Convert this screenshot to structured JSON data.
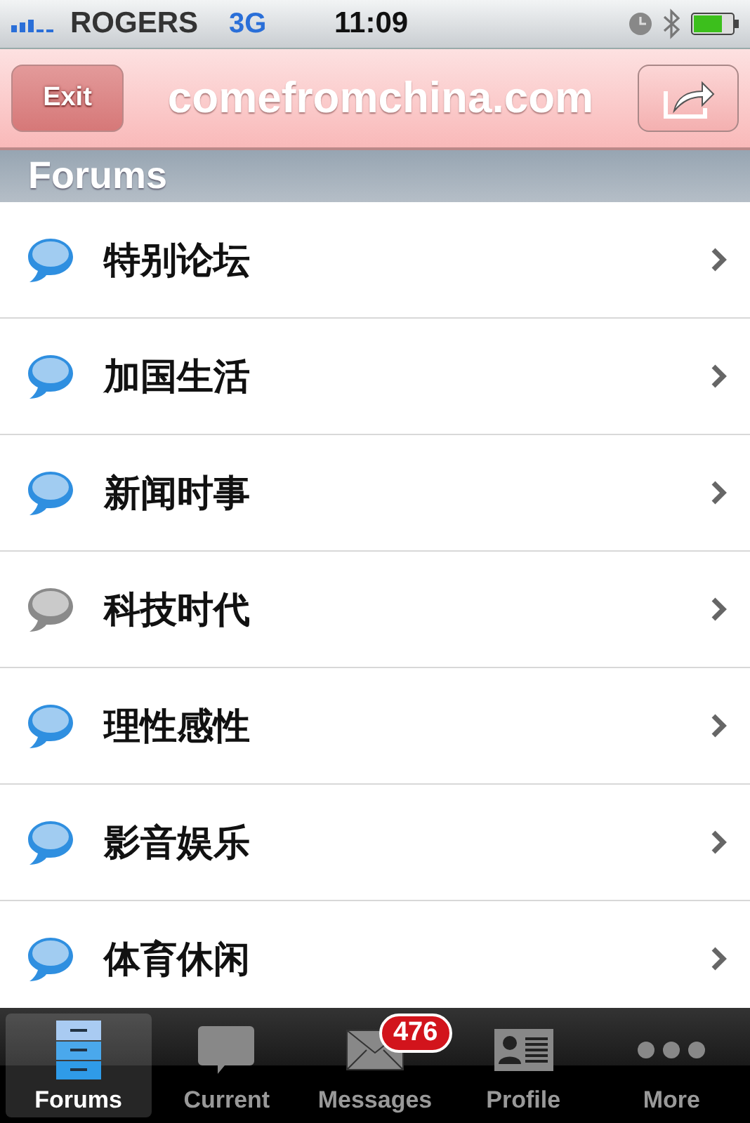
{
  "status_bar": {
    "carrier": "ROGERS",
    "network": "3G",
    "time": "11:09"
  },
  "header": {
    "exit": "Exit",
    "title": "comefromchina.com"
  },
  "section": {
    "title": "Forums"
  },
  "forums": [
    {
      "name": "特别论坛",
      "color": "#2f8fe0"
    },
    {
      "name": "加国生活",
      "color": "#2f8fe0"
    },
    {
      "name": "新闻时事",
      "color": "#2f8fe0"
    },
    {
      "name": "科技时代",
      "color": "#8a8a8a"
    },
    {
      "name": "理性感性",
      "color": "#2f8fe0"
    },
    {
      "name": "影音娱乐",
      "color": "#2f8fe0"
    },
    {
      "name": "体育休闲",
      "color": "#2f8fe0"
    }
  ],
  "tabs": [
    {
      "label": "Forums",
      "kind": "folder",
      "selected": true
    },
    {
      "label": "Current",
      "kind": "chat",
      "selected": false
    },
    {
      "label": "Messages",
      "kind": "mail",
      "selected": false,
      "badge": "476"
    },
    {
      "label": "Profile",
      "kind": "profile",
      "selected": false
    },
    {
      "label": "More",
      "kind": "more",
      "selected": false
    }
  ]
}
